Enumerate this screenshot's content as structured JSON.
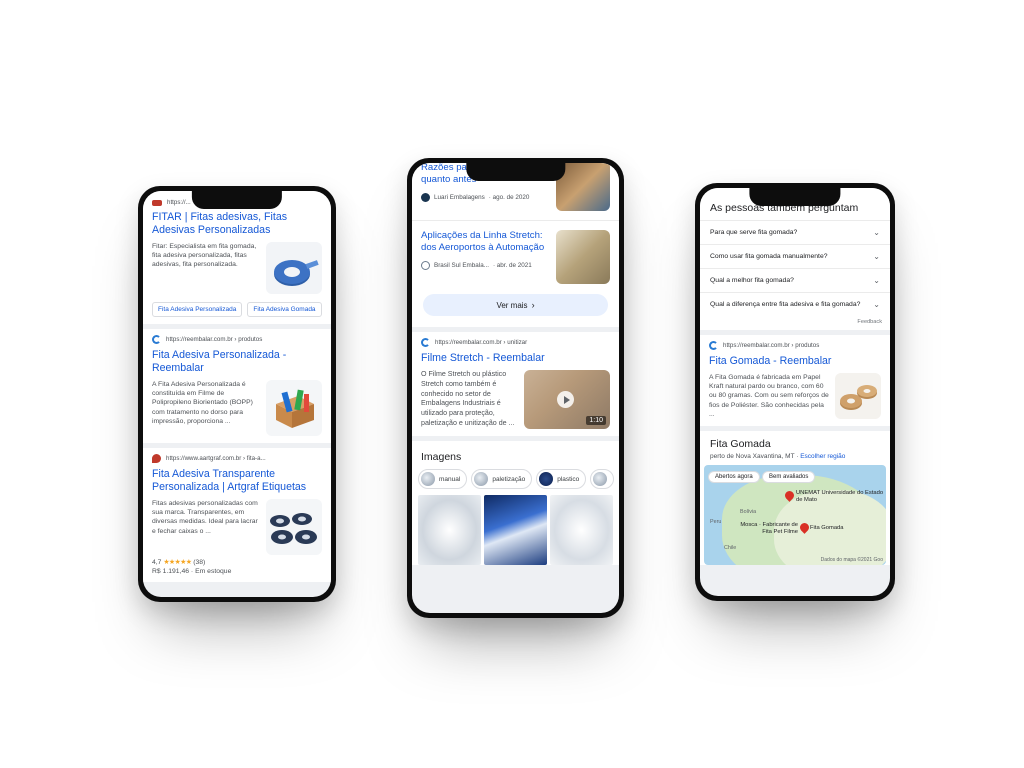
{
  "left_phone": {
    "result1": {
      "url": "https://...",
      "title": "FITAR | Fitas adesivas, Fitas Adesivas Personalizadas",
      "snippet": "Fitar: Especialista em fita gomada, fita adesiva personalizada, fitas adesivas, fita personalizada.",
      "pills": [
        "Fita Adesiva Personalizada",
        "Fita Adesiva Gomada"
      ]
    },
    "result2": {
      "url": "https://reembalar.com.br › produtos",
      "title": "Fita Adesiva Personalizada - Reembalar",
      "snippet": "A Fita Adesiva Personalizada é constituída em Filme de Polipropileno Biorientado (BOPP) com tratamento no dorso para impressão, proporciona ..."
    },
    "result3": {
      "url": "https://www.aartgraf.com.br › fita-a...",
      "title": "Fita Adesiva Transparente Personalizada | Artgraf Etiquetas",
      "snippet": "Fitas adesivas personalizadas com sua marca. Transparentes, em diversas medidas. Ideal para lacrar e fechar caixas o ...",
      "rating": "4,7",
      "stars": "★★★★★",
      "reviews": "(38)",
      "price": "R$ 1.191,46 · Em estoque"
    }
  },
  "center_phone": {
    "news1": {
      "title": "Razões para utilizar o ... quanto antes",
      "source": "Luari Embalagens",
      "date": "· ago. de 2020"
    },
    "news2": {
      "title": "Aplicações da Linha Stretch: dos Aeroportos à Automação",
      "source": "Brasil Sul Embala...",
      "date": "· abr. de 2021"
    },
    "ver_mais": "Ver mais",
    "ver_mais_icon": "chevron-right",
    "result": {
      "url": "https://reembalar.com.br › unitizar",
      "title": "Filme Stretch - Reembalar",
      "snippet": "O Filme Stretch ou plástico Stretch como também é conhecido no setor de Embalagens Industriais é utilizado para proteção, paletização e unitização de ...",
      "video_duration": "1:10"
    },
    "images": {
      "heading": "Imagens",
      "chips": [
        "manual",
        "paletização",
        "plastico"
      ]
    }
  },
  "right_phone": {
    "paa_title": "As pessoas também perguntam",
    "questions": [
      "Para que serve fita gomada?",
      "Como usar fita gomada manualmente?",
      "Qual a melhor fita gomada?",
      "Qual a diferença entre fita adesiva e fita gomada?"
    ],
    "feedback": "Feedback",
    "result": {
      "url": "https://reembalar.com.br › produtos",
      "title": "Fita Gomada - Reembalar",
      "snippet": "A Fita Gomada é fabricada em Papel Kraft natural pardo ou branco, com 60 ou 80 gramas. Com ou sem reforços de fios de Poliéster. São conhecidas pela ..."
    },
    "local": {
      "heading": "Fita Gomada",
      "near": "perto de Nova Xavantina, MT ·",
      "choose_region": "Escolher região",
      "chips": [
        "Abertos agora",
        "Bem avaliados"
      ],
      "pins": [
        "UNEMAT Universidade do Estado de Mato",
        "Mosca · Fabricante de Fita Pet Filme",
        "Fita Gomada"
      ],
      "countries": [
        "Peru",
        "Bolívia",
        "Chile"
      ],
      "attribution": "Dados do mapa ©2021 Goo"
    }
  }
}
